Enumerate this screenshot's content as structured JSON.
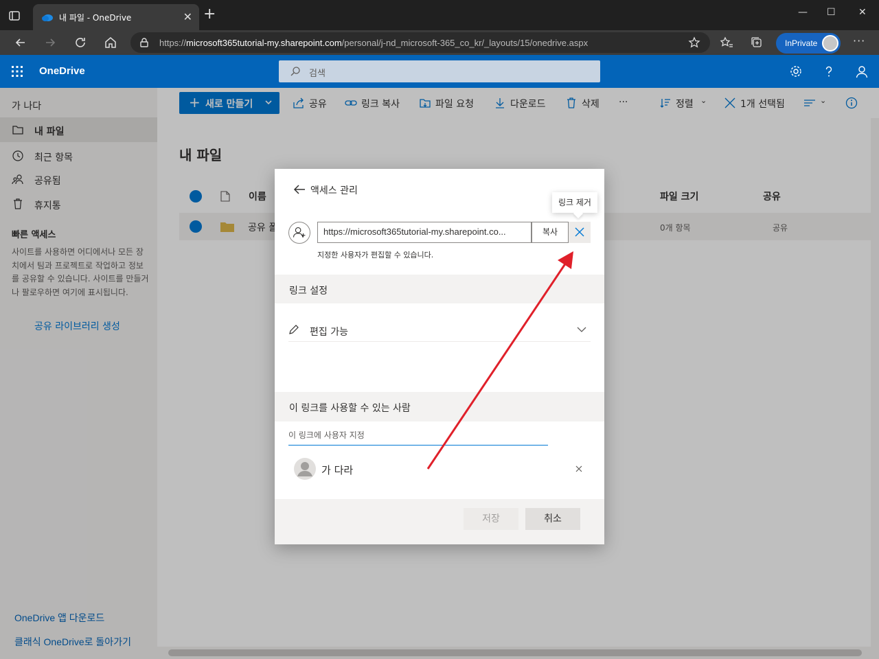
{
  "browser": {
    "tab_title": "내 파일 - OneDrive",
    "url_prefix": "https://",
    "url_host": "microsoft365tutorial-my.sharepoint.com",
    "url_path": "/personal/j-nd_microsoft-365_co_kr/_layouts/15/onedrive.aspx",
    "inprivate_label": "InPrivate"
  },
  "suite": {
    "brand": "OneDrive",
    "search_placeholder": "검색"
  },
  "nav": {
    "user_name": "가 나다",
    "items": [
      {
        "label": "내 파일",
        "icon": "folder-icon",
        "selected": true
      },
      {
        "label": "최근 항목",
        "icon": "clock-icon"
      },
      {
        "label": "공유됨",
        "icon": "people-icon"
      },
      {
        "label": "휴지통",
        "icon": "trash-icon"
      }
    ],
    "quick_access_title": "빠른 액세스",
    "quick_access_desc": "사이트를 사용하면 어디에서나 모든 장치에서 팀과 프로젝트로 작업하고 정보를 공유할 수 있습니다. 사이트를 만들거나 팔로우하면 여기에 표시됩니다.",
    "create_library_link": "공유 라이브러리 생성",
    "download_app_link": "OneDrive 앱 다운로드",
    "classic_link": "클래식 OneDrive로 돌아가기"
  },
  "commands": {
    "new": "새로 만들기",
    "share": "공유",
    "copy_link": "링크 복사",
    "file_request": "파일 요청",
    "download": "다운로드",
    "delete": "삭제",
    "more": "···",
    "sort": "정렬",
    "selected_count": "1개 선택됨"
  },
  "main": {
    "title": "내 파일",
    "columns": {
      "name": "이름",
      "file_size": "파일 크기",
      "sharing": "공유"
    },
    "rows": [
      {
        "name": "공유 폴",
        "file_size": "0개 항목",
        "sharing": "공유"
      }
    ]
  },
  "dialog": {
    "title": "액세스 관리",
    "tooltip": "링크 제거",
    "link_url": "https://microsoft365tutorial-my.sharepoint.co...",
    "copy_label": "복사",
    "permission_note": "지정한 사용자가 편집할 수 있습니다.",
    "link_settings_title": "링크 설정",
    "permission_value": "편집 가능",
    "who_title": "이 링크를 사용할 수 있는 사람",
    "people_placeholder": "이 링크에 사용자 지정",
    "person_name": "가 다라",
    "save_label": "저장",
    "cancel_label": "취소"
  },
  "colors": {
    "suite_blue": "#0364b8",
    "accent": "#0078d4",
    "arrow_red": "#e0202a"
  }
}
